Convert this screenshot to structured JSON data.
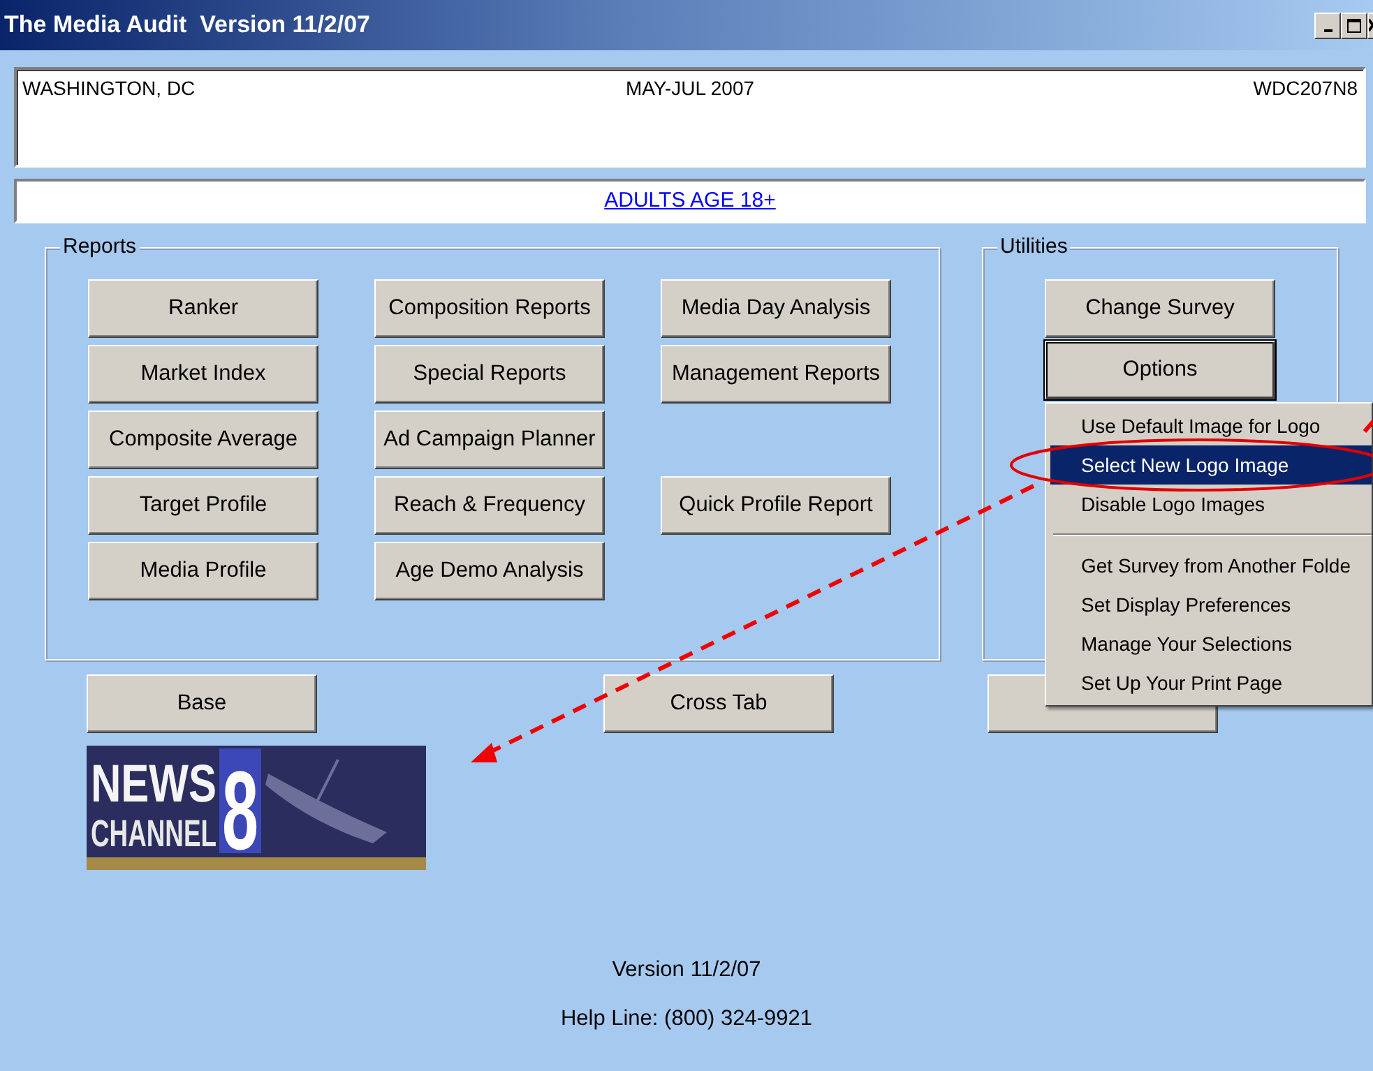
{
  "window": {
    "title": "The Media Audit  Version 11/2/07"
  },
  "header": {
    "market": "WASHINGTON, DC",
    "period": "MAY-JUL 2007",
    "code": "WDC207N8"
  },
  "audience": {
    "link": "ADULTS AGE 18+"
  },
  "reports": {
    "title": "Reports",
    "columns": [
      [
        {
          "kind": "button",
          "label": "Ranker"
        },
        {
          "kind": "button",
          "label": "Market Index"
        },
        {
          "kind": "button",
          "label": "Composite Average"
        },
        {
          "kind": "button",
          "label": "Target Profile"
        },
        {
          "kind": "button",
          "label": "Media Profile"
        }
      ],
      [
        {
          "kind": "button",
          "label": "Composition Reports"
        },
        {
          "kind": "button",
          "label": "Special Reports"
        },
        {
          "kind": "button",
          "label": "Ad Campaign Planner"
        },
        {
          "kind": "button",
          "label": "Reach & Frequency"
        },
        {
          "kind": "button",
          "label": "Age Demo Analysis"
        }
      ],
      [
        {
          "kind": "button",
          "label": "Media Day Analysis"
        },
        {
          "kind": "button",
          "label": "Management Reports"
        },
        {
          "kind": "gap"
        },
        {
          "kind": "button",
          "label": "Quick Profile Report"
        }
      ]
    ]
  },
  "utilities": {
    "title": "Utilities",
    "buttons": [
      {
        "label": "Change Survey",
        "focused": false
      },
      {
        "label": "Options",
        "focused": true
      }
    ]
  },
  "bottom_buttons": [
    {
      "kind": "button",
      "label": "Base"
    },
    {
      "kind": "button",
      "label": "Cross Tab"
    },
    {
      "kind": "covered"
    }
  ],
  "logo": {
    "line1": "NEWS",
    "line2": "CHANNEL",
    "number": "8"
  },
  "options_menu": [
    {
      "kind": "item",
      "label": "Use Default Image for Logo",
      "selected": false
    },
    {
      "kind": "item",
      "label": "Select New Logo Image",
      "selected": true
    },
    {
      "kind": "item",
      "label": "Disable Logo Images",
      "selected": false
    },
    {
      "kind": "separator"
    },
    {
      "kind": "item",
      "label": "Get Survey from Another Folde",
      "selected": false
    },
    {
      "kind": "item",
      "label": "Set Display Preferences",
      "selected": false
    },
    {
      "kind": "item",
      "label": "Manage Your Selections",
      "selected": false
    },
    {
      "kind": "item",
      "label": "Set Up Your Print Page",
      "selected": false
    }
  ],
  "footer": {
    "version": "Version 11/2/07",
    "help": "Help Line: (800) 324-9921"
  }
}
